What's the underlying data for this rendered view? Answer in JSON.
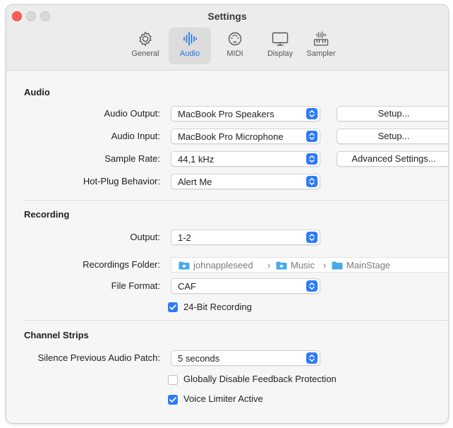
{
  "window": {
    "title": "Settings"
  },
  "tabs": [
    {
      "label": "General",
      "icon": "gear-icon"
    },
    {
      "label": "Audio",
      "icon": "waveform-icon",
      "active": true
    },
    {
      "label": "MIDI",
      "icon": "midi-connector-icon"
    },
    {
      "label": "Display",
      "icon": "display-icon"
    },
    {
      "label": "Sampler",
      "icon": "sampler-keyboard-icon"
    }
  ],
  "audio": {
    "title": "Audio",
    "output_label": "Audio Output:",
    "output_value": "MacBook Pro Speakers",
    "output_setup": "Setup...",
    "input_label": "Audio Input:",
    "input_value": "MacBook Pro Microphone",
    "input_setup": "Setup...",
    "rate_label": "Sample Rate:",
    "rate_value": "44,1 kHz",
    "advanced": "Advanced Settings...",
    "hotplug_label": "Hot-Plug Behavior:",
    "hotplug_value": "Alert Me"
  },
  "recording": {
    "title": "Recording",
    "output_label": "Output:",
    "output_value": "1-2",
    "folder_label": "Recordings Folder:",
    "path": [
      "johnappleseed",
      "Music",
      "MainStage"
    ],
    "separator": "›",
    "format_label": "File Format:",
    "format_value": "CAF",
    "bit24_label": "24-Bit Recording",
    "bit24_checked": true
  },
  "channel_strips": {
    "title": "Channel Strips",
    "silence_label": "Silence Previous Audio Patch:",
    "silence_value": "5 seconds",
    "feedback_label": "Globally Disable Feedback Protection",
    "feedback_checked": false,
    "limiter_label": "Voice Limiter Active",
    "limiter_checked": true
  },
  "colors": {
    "accent": "#2d7cf6",
    "close": "#ff5f57"
  }
}
